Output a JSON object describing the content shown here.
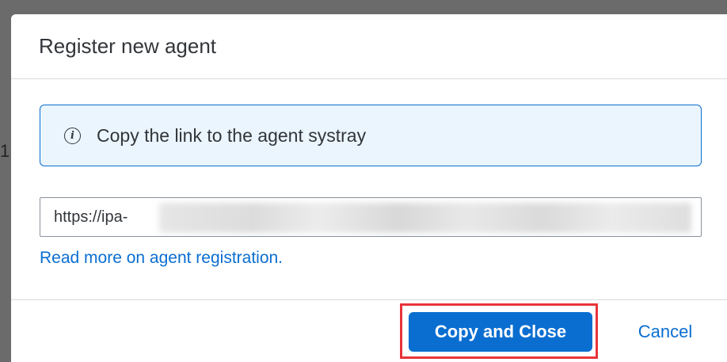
{
  "backdrop": {
    "partial_text": "1"
  },
  "dialog": {
    "title": "Register new agent",
    "info_strip": {
      "icon": "info-icon",
      "icon_glyph": "i",
      "text": "Copy the link to the agent systray"
    },
    "link_field": {
      "value": "https://ipa-"
    },
    "read_more_link": "Read more on agent registration.",
    "footer": {
      "primary_button": "Copy and Close",
      "secondary_button": "Cancel"
    }
  },
  "colors": {
    "accent": "#0a6ed1",
    "info_background": "#ebf5fe",
    "highlight": "#e8343a",
    "text": "#32363a",
    "overlay": "#6b6b6b"
  }
}
